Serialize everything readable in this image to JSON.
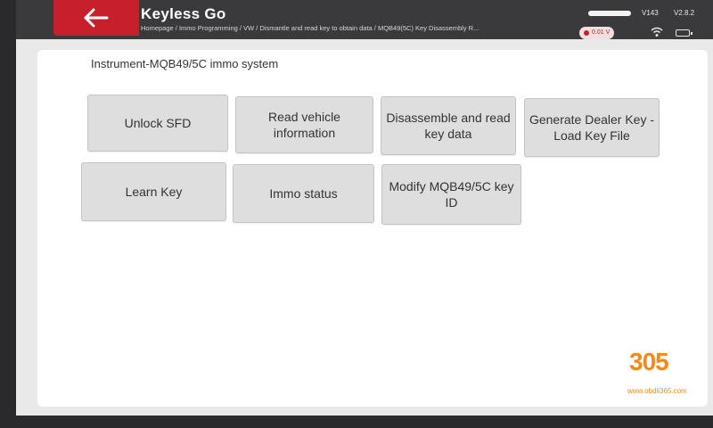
{
  "header": {
    "title": "Keyless Go",
    "breadcrumb": "Homepage / Immo Programming / VW / Dismantle and read key to obtain data / MQB49(5C) Key Disassembly R...",
    "vin_version": "V143",
    "app_version": "V2.8.2",
    "voltage": "0.01 V",
    "back_icon": "back-arrow-icon",
    "colors": {
      "header_bg": "#3a3a3c",
      "back_bg": "#c8202a"
    }
  },
  "content": {
    "section_title": "Instrument-MQB49/5C immo system",
    "functions": [
      {
        "label": "Unlock SFD"
      },
      {
        "label": "Read vehicle information"
      },
      {
        "label": "Disassemble and read key data"
      },
      {
        "label": "Generate Dealer Key - Load Key File"
      },
      {
        "label": "Learn Key"
      },
      {
        "label": "Immo status"
      },
      {
        "label": "Modify MQB49/5C key ID"
      }
    ]
  },
  "watermark": {
    "logo": "305",
    "url": "www.obdii365.com"
  }
}
